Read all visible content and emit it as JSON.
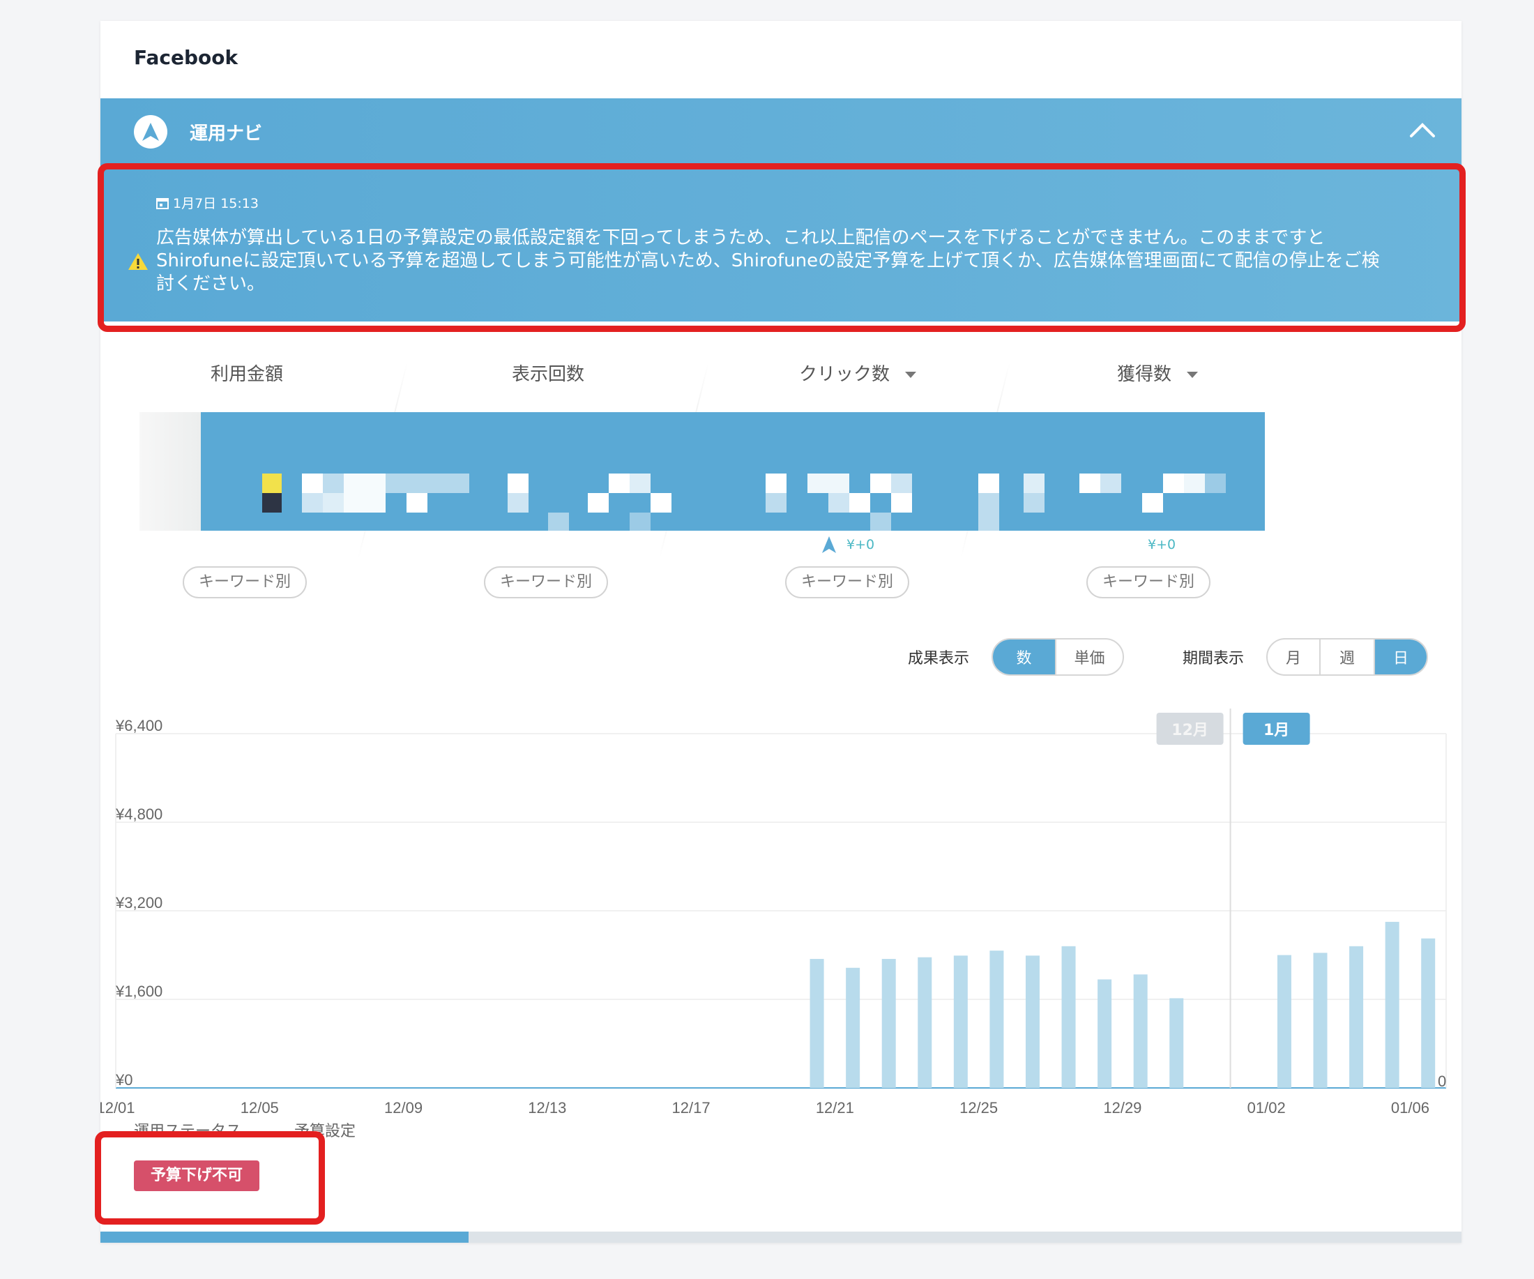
{
  "card": {
    "title": "Facebook"
  },
  "navi": {
    "title": "運用ナビ",
    "icon": "navigation-arrow-icon",
    "collapse_icon": "chevron-up-icon"
  },
  "alert": {
    "date": "1月7日 15:13",
    "message": "広告媒体が算出している1日の予算設定の最低設定額を下回ってしまうため、これ以上配信のペースを下げることができません。このままですとShirofuneに設定頂いている予算を超過してしまう可能性が高いため、Shirofuneの設定予算を上げて頂くか、広告媒体管理画面にて配信の停止をご検討ください。"
  },
  "metrics": [
    {
      "label": "利用金額",
      "button": "キーワード別",
      "delta": ""
    },
    {
      "label": "表示回数",
      "button": "キーワード別",
      "delta": ""
    },
    {
      "label": "クリック数",
      "button": "キーワード別",
      "delta": "¥+0"
    },
    {
      "label": "獲得数",
      "button": "キーワード別",
      "delta": "¥+0"
    }
  ],
  "controls": {
    "result_label": "成果表示",
    "result_options": [
      "数",
      "単価"
    ],
    "result_selected": "数",
    "period_label": "期間表示",
    "period_options": [
      "月",
      "週",
      "日"
    ],
    "period_selected": "日"
  },
  "chart_data": {
    "type": "bar",
    "y_ticks": [
      "¥6,400",
      "¥4,800",
      "¥3,200",
      "¥1,600",
      "¥0"
    ],
    "right_axis_label": "0",
    "ylim": [
      0,
      6400
    ],
    "x_ticks": [
      "12/01",
      "12/05",
      "12/09",
      "12/13",
      "12/17",
      "12/21",
      "12/25",
      "12/29",
      "01/02",
      "01/06"
    ],
    "month_markers": [
      "12月",
      "1月"
    ],
    "categories": [
      "12/20",
      "12/21",
      "12/22",
      "12/23",
      "12/24",
      "12/25",
      "12/26",
      "12/27",
      "12/28",
      "12/29",
      "12/30",
      "01/02",
      "01/03",
      "01/04",
      "01/05",
      "01/06"
    ],
    "values": [
      2330,
      2170,
      2330,
      2360,
      2390,
      2480,
      2390,
      2560,
      1960,
      2050,
      1620,
      2400,
      2440,
      2560,
      3000,
      2700
    ],
    "grid": true,
    "colors": {
      "bar": "#b8dbec",
      "axis": "#5aa9d5"
    }
  },
  "status": {
    "labels": [
      "運用ステータス",
      "予算設定"
    ],
    "badge": "予算下げ不可"
  }
}
